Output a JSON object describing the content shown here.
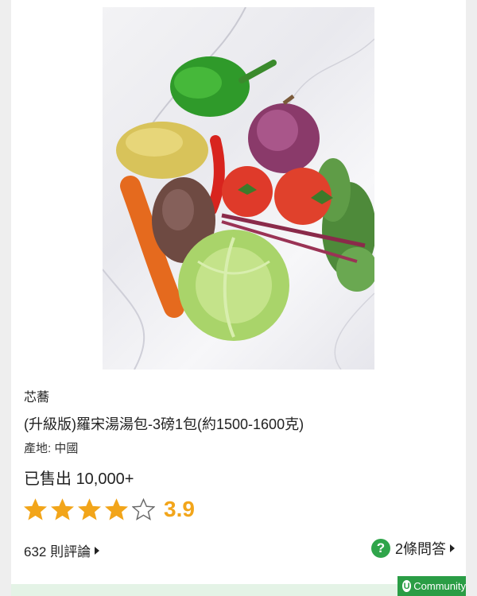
{
  "product": {
    "brand": "芯蕎",
    "title": " (升級版)羅宋湯湯包-3磅1包(約1500-1600克)",
    "origin_label": "產地: ",
    "origin_value": "中國",
    "sold_label": "已售出 ",
    "sold_value": "10,000+",
    "rating": 3.9,
    "rating_text": "3.9",
    "stars_filled": 4,
    "stars_total": 5,
    "reviews_text": "632 則評論",
    "qa_text": "2條問答",
    "qa_icon": "?"
  },
  "colors": {
    "star": "#f2a51a",
    "qa_green": "#2fa54a",
    "brand_green": "#2a9d45"
  },
  "watermark": {
    "logo_letter": "U",
    "text": "Community"
  }
}
